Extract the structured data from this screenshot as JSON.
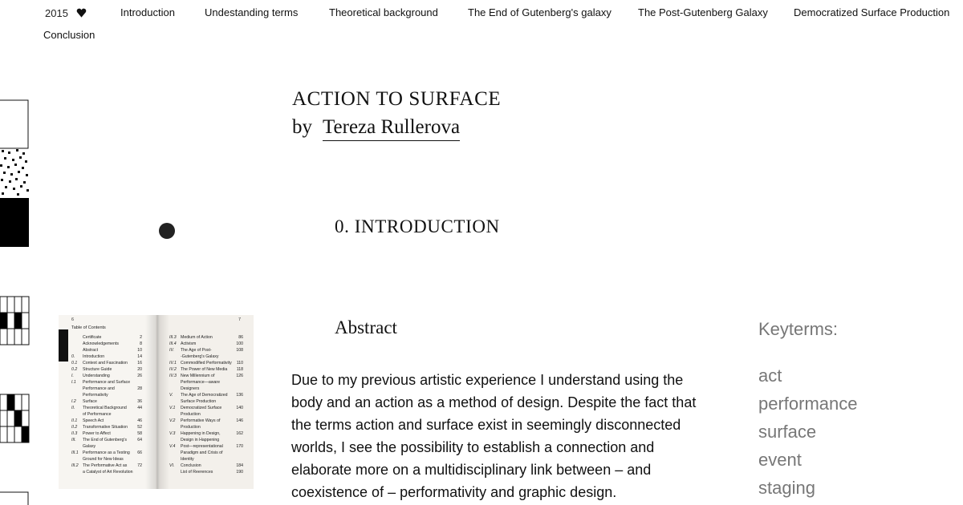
{
  "nav": {
    "year": "2015",
    "heart_icon": "heart-icon",
    "links": [
      "Introduction",
      "Undestanding terms",
      "Theoretical background",
      "The End of Gutenberg's galaxy",
      "The Post-Gutenberg Galaxy",
      "Democratized Surface Production",
      "Conclusion"
    ]
  },
  "title": {
    "line1": "ACTION TO SURFACE",
    "by": "by",
    "author": "Tereza Rullerova"
  },
  "section_heading": "0. INTRODUCTION",
  "book": {
    "left_page_number": "6",
    "right_page_number": "7",
    "toc_title": "Table of Contents",
    "left_rows": [
      {
        "n": "",
        "t": "Certificate",
        "p": "2"
      },
      {
        "n": "",
        "t": "Acknowledgements",
        "p": "8"
      },
      {
        "n": "",
        "t": "Abstract",
        "p": "10"
      },
      {
        "n": "0.",
        "t": "Introduction",
        "p": "14"
      },
      {
        "n": "0.1",
        "t": "Context and Fascination",
        "p": "16"
      },
      {
        "n": "0.2",
        "t": "Structure Guide",
        "p": "20"
      },
      {
        "n": "I.",
        "t": "Understanding",
        "p": "26"
      },
      {
        "n": "I.1",
        "t": "Performance and Surface",
        "p": ""
      },
      {
        "n": "",
        "t": "Performance and",
        "p": "28"
      },
      {
        "n": "",
        "t": "Performativity",
        "p": ""
      },
      {
        "n": "I.2",
        "t": "Surface",
        "p": "36"
      },
      {
        "n": "II.",
        "t": "Theoretical Background",
        "p": "44"
      },
      {
        "n": "",
        "t": "of Performance",
        "p": ""
      },
      {
        "n": "II.1",
        "t": "Speech Act",
        "p": "46"
      },
      {
        "n": "II.2",
        "t": "Transformative Situation",
        "p": "52"
      },
      {
        "n": "II.3",
        "t": "Power to Affect",
        "p": "58"
      },
      {
        "n": "III.",
        "t": "The End of Gutenberg's",
        "p": "64"
      },
      {
        "n": "",
        "t": "Galaxy",
        "p": ""
      },
      {
        "n": "III.1",
        "t": "Performance as a Testing",
        "p": "66"
      },
      {
        "n": "",
        "t": "Ground for New Ideas",
        "p": ""
      },
      {
        "n": "III.2",
        "t": "The Performative Act as",
        "p": "72"
      },
      {
        "n": "",
        "t": "a Catalyst of Art Revolution",
        "p": ""
      }
    ],
    "right_rows": [
      {
        "n": "III.3",
        "t": "Medium of Action",
        "p": "86"
      },
      {
        "n": "III.4",
        "t": "Activism",
        "p": "100"
      },
      {
        "n": "IV.",
        "t": "The Age of Post-",
        "p": "108"
      },
      {
        "n": "",
        "t": "-Gutenberg's Galaxy",
        "p": ""
      },
      {
        "n": "IV.1",
        "t": "Commodified Performativity",
        "p": "110"
      },
      {
        "n": "IV.2",
        "t": "The Power of New Media",
        "p": "118"
      },
      {
        "n": "IV.3",
        "t": "New Millennium of",
        "p": "126"
      },
      {
        "n": "",
        "t": "Performance—aware",
        "p": ""
      },
      {
        "n": "",
        "t": "Designers",
        "p": ""
      },
      {
        "n": "V.",
        "t": "The Age of Democratized",
        "p": "136"
      },
      {
        "n": "",
        "t": "Surface Production",
        "p": ""
      },
      {
        "n": "V.1",
        "t": "Democratized Surface",
        "p": "140"
      },
      {
        "n": "",
        "t": "Production",
        "p": ""
      },
      {
        "n": "V.2",
        "t": "Performative Ways of",
        "p": "146"
      },
      {
        "n": "",
        "t": "Production",
        "p": ""
      },
      {
        "n": "V.3",
        "t": "Happening in Design,",
        "p": "162"
      },
      {
        "n": "",
        "t": "Design in Happening",
        "p": ""
      },
      {
        "n": "V.4",
        "t": "Post—representational",
        "p": "170"
      },
      {
        "n": "",
        "t": "Paradigm and Crisis of",
        "p": ""
      },
      {
        "n": "",
        "t": "Identity",
        "p": ""
      },
      {
        "n": "VI.",
        "t": "Conclusion",
        "p": "184"
      },
      {
        "n": "",
        "t": "List of Reerences",
        "p": "190"
      }
    ]
  },
  "abstract": {
    "heading": "Abstract",
    "body": "Due to my previous artistic experience I understand using the body and an action as a method of design. Despite the fact that the terms action and surface exist in seemingly disconnected worlds, I see the possibility to establish a connection and elaborate more on a multidisciplinary link between – and coexistence of – performativity and graphic design."
  },
  "keyterms": {
    "heading": "Keyterms:",
    "items": [
      "act",
      "performance",
      "surface",
      "event",
      "staging"
    ]
  }
}
